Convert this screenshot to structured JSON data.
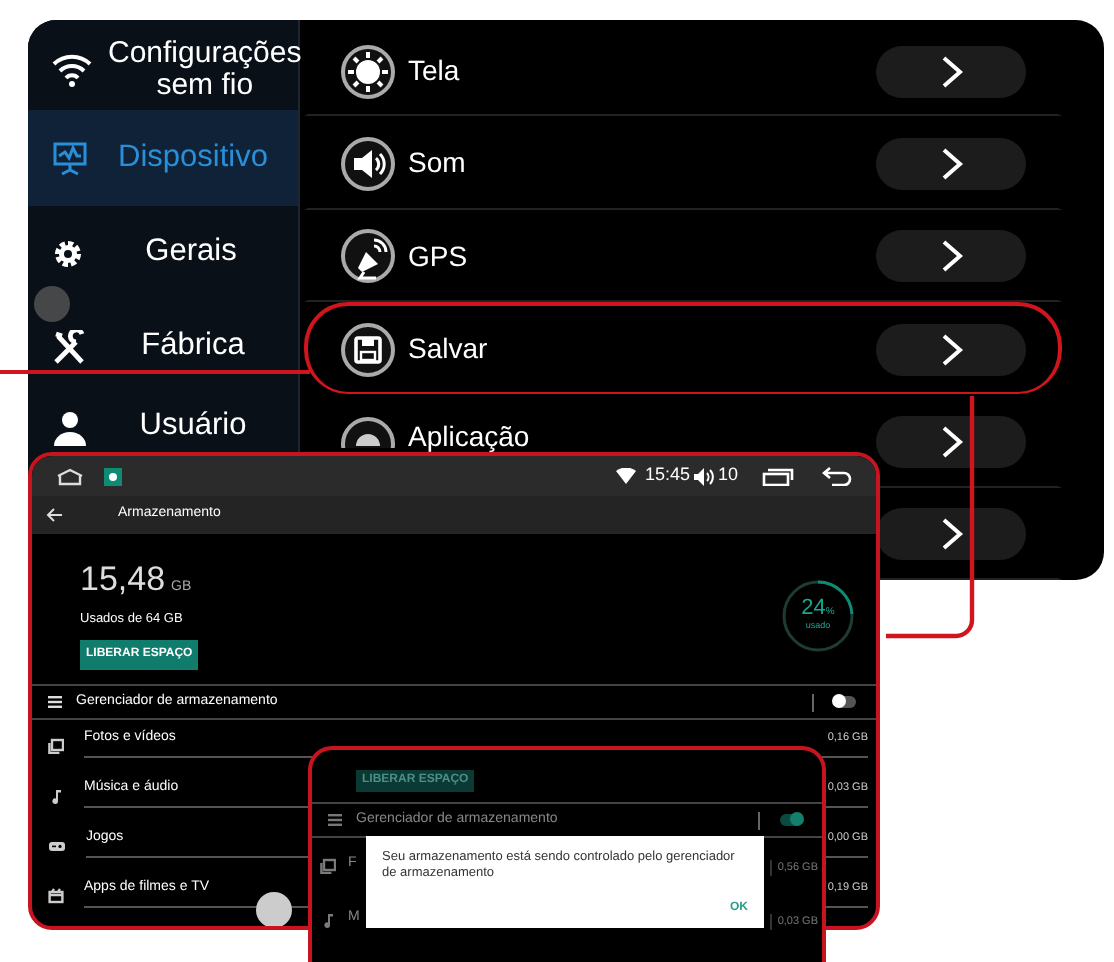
{
  "head_unit": {
    "sidebar": [
      {
        "label": "Configurações sem fio",
        "selected": false
      },
      {
        "label": "Dispositivo",
        "selected": true
      },
      {
        "label": "Gerais",
        "selected": false
      },
      {
        "label": "Fábrica",
        "selected": false
      },
      {
        "label": "Usuário",
        "selected": false
      }
    ],
    "menu": [
      {
        "label": "Tela",
        "highlighted": false
      },
      {
        "label": "Som",
        "highlighted": false
      },
      {
        "label": "GPS",
        "highlighted": false
      },
      {
        "label": "Salvar",
        "highlighted": true
      },
      {
        "label": "Aplicação",
        "highlighted": false
      },
      {
        "highlighted": false
      }
    ]
  },
  "storage_screen": {
    "status_bar": {
      "time": "15:45",
      "volume": "10"
    },
    "title": "Armazenamento",
    "used": "15,48",
    "used_unit": "GB",
    "used_of": "Usados de 64 GB",
    "free_button": "LIBERAR ESPAÇO",
    "percent": "24",
    "percent_unit": "%",
    "percent_label": "usado",
    "level": 0.24,
    "manager": {
      "label": "Gerenciador de armazenamento",
      "on": false
    },
    "categories": [
      {
        "label": "Fotos e vídeos",
        "size": "0,16 GB"
      },
      {
        "label": "Música e áudio",
        "size": "0,03 GB"
      },
      {
        "label": "Jogos",
        "size": "0,00 GB"
      },
      {
        "label": "Apps de filmes e TV",
        "size": "0,19 GB"
      }
    ]
  },
  "zoom_inset": {
    "free_button": "LIBERAR ESPAÇO",
    "manager": {
      "label": "Gerenciador de armazenamento",
      "on": true
    },
    "rows": [
      {
        "label": "F",
        "size": "0,56 GB"
      },
      {
        "label": "M",
        "size": "0,03 GB"
      }
    ],
    "dialog": {
      "message": "Seu armazenamento está sendo controlado pelo gerenciador de armazenamento",
      "button": "OK"
    }
  }
}
